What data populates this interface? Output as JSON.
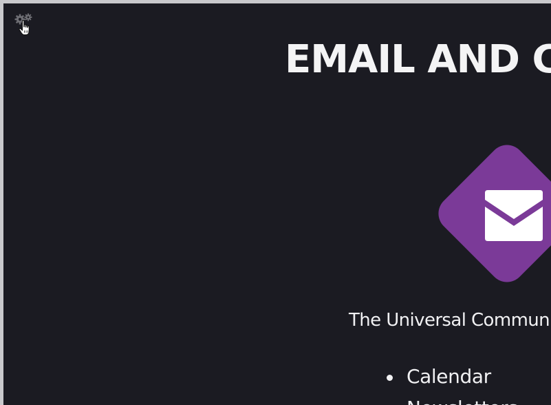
{
  "page": {
    "title": "EMAIL AND CALENDAR",
    "tagline": "The Universal Communication App",
    "settings_icon": "gears-icon",
    "cursor_icon": "hand-pointer-icon",
    "logo_icon": "envelope-icon"
  },
  "features": [
    {
      "label": "Calendar"
    },
    {
      "label": "Newsletters"
    }
  ],
  "colors": {
    "background": "#1b1b22",
    "text": "#f4f4f5",
    "brand_purple": "#7b3a98",
    "envelope": "#ffffff"
  }
}
